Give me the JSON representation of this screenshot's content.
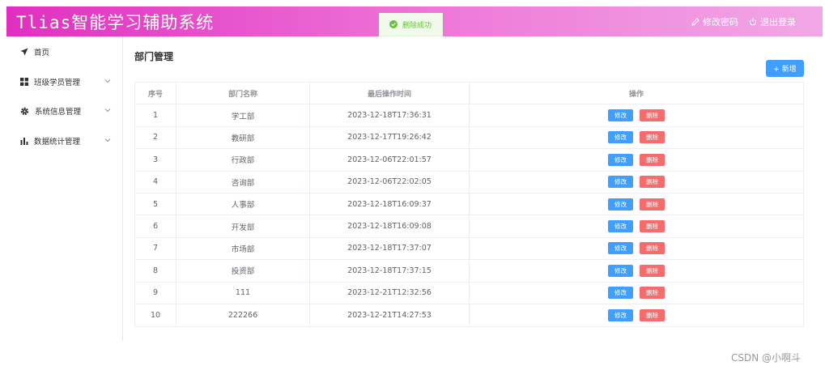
{
  "header": {
    "title": "Tlias智能学习辅助系统",
    "change_password": "修改密码",
    "logout": "退出登录",
    "gradient_start": "#e02fc0",
    "gradient_end": "#f2a8e6"
  },
  "toast": {
    "text": "删除成功",
    "color": "#67c23a"
  },
  "sidebar": {
    "items": [
      {
        "label": "首页",
        "icon": "paper-plane-icon"
      },
      {
        "label": "班级学员管理",
        "icon": "grid-icon"
      },
      {
        "label": "系统信息管理",
        "icon": "gear-icon"
      },
      {
        "label": "数据统计管理",
        "icon": "bar-chart-icon"
      }
    ]
  },
  "main": {
    "title": "部门管理",
    "add_button": "+ 新增",
    "table": {
      "columns": [
        "序号",
        "部门名称",
        "最后操作时间",
        "操作"
      ],
      "edit_label": "修改",
      "delete_label": "删除",
      "rows": [
        {
          "index": "1",
          "name": "学工部",
          "time": "2023-12-18T17:36:31"
        },
        {
          "index": "2",
          "name": "教研部",
          "time": "2023-12-17T19:26:42"
        },
        {
          "index": "3",
          "name": "行政部",
          "time": "2023-12-06T22:01:57"
        },
        {
          "index": "4",
          "name": "咨询部",
          "time": "2023-12-06T22:02:05"
        },
        {
          "index": "5",
          "name": "人事部",
          "time": "2023-12-18T16:09:37"
        },
        {
          "index": "6",
          "name": "开发部",
          "time": "2023-12-18T16:09:08"
        },
        {
          "index": "7",
          "name": "市场部",
          "time": "2023-12-18T17:37:07"
        },
        {
          "index": "8",
          "name": "投资部",
          "time": "2023-12-18T17:37:15"
        },
        {
          "index": "9",
          "name": "111",
          "time": "2023-12-21T12:32:56"
        },
        {
          "index": "10",
          "name": "222266",
          "time": "2023-12-21T14:27:53"
        }
      ]
    },
    "accent": "#409eff",
    "danger": "#f56c6c"
  },
  "watermark": "CSDN @小啊斗"
}
